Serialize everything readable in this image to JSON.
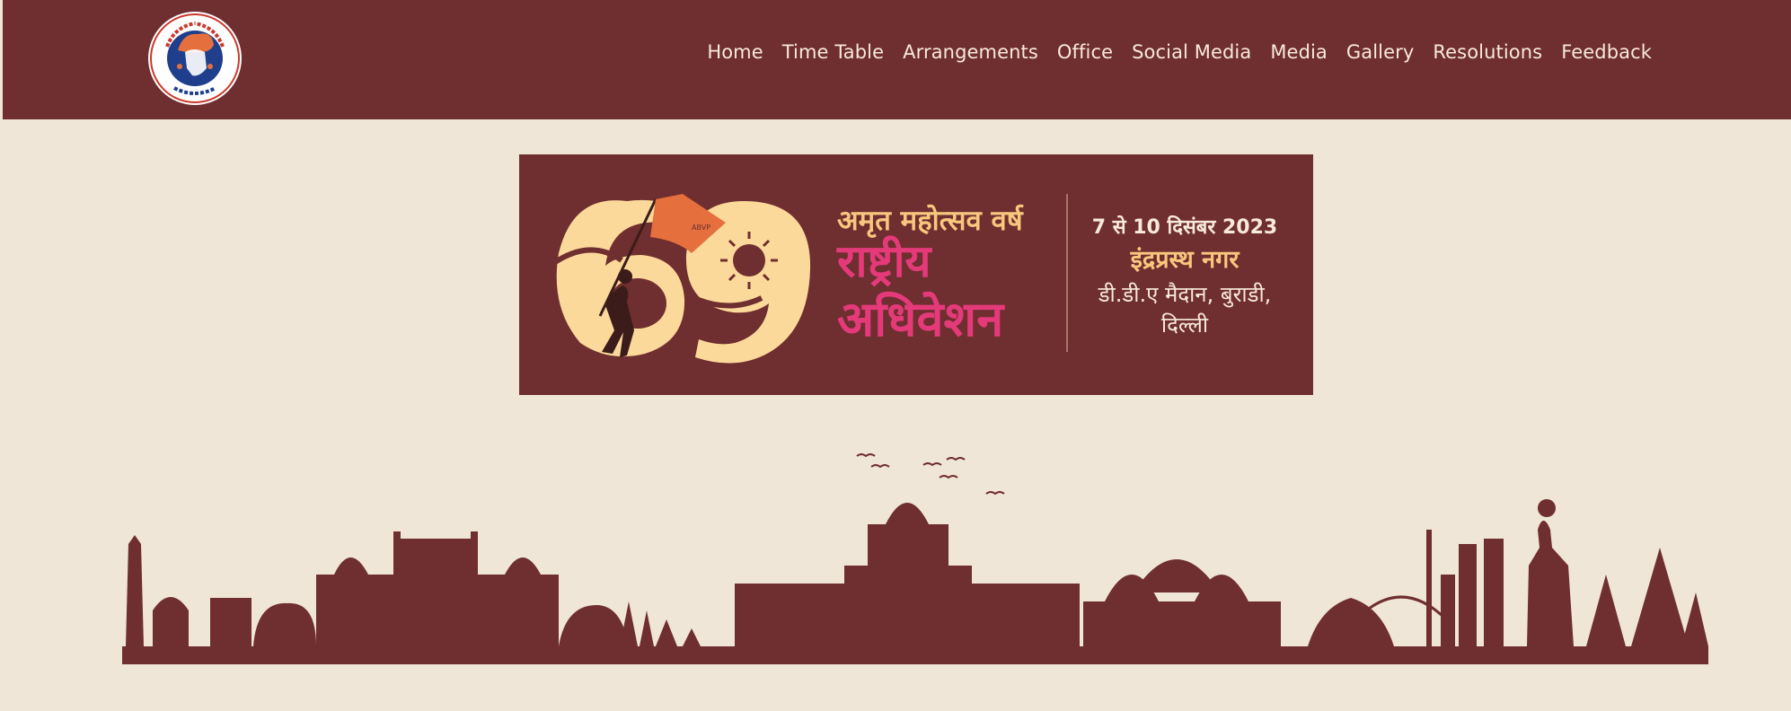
{
  "header": {
    "logo": {
      "seal_text_top": "अखिल भारतीय विद्यार्थी परिषद",
      "seal_text_bottom": "ज्ञान शील एकता"
    },
    "nav": [
      {
        "label": "Home"
      },
      {
        "label": "Time Table"
      },
      {
        "label": "Arrangements"
      },
      {
        "label": "Office"
      },
      {
        "label": "Social Media"
      },
      {
        "label": "Media"
      },
      {
        "label": "Gallery"
      },
      {
        "label": "Resolutions"
      },
      {
        "label": "Feedback"
      }
    ]
  },
  "banner": {
    "number": "69",
    "flag_text": "ABVP",
    "tagline": "अमृत महोत्सव वर्ष",
    "title_line1": "राष्ट्रीय",
    "title_line2": "अधिवेशन",
    "date": "7 से 10 दिसंबर 2023",
    "venue_name": "इंद्रप्रस्थ नगर",
    "address_line1": "डी.डी.ए मैदान, बुराडी,",
    "address_line2": "दिल्ली"
  },
  "colors": {
    "brand_maroon": "#6f2e2f",
    "background_cream": "#efe6d8",
    "nav_text": "#f7e9dc",
    "banner_yellow": "#fbd99a",
    "banner_orange": "#e5703d",
    "banner_pink": "#e43a7a",
    "banner_gold": "#f7c77e"
  }
}
